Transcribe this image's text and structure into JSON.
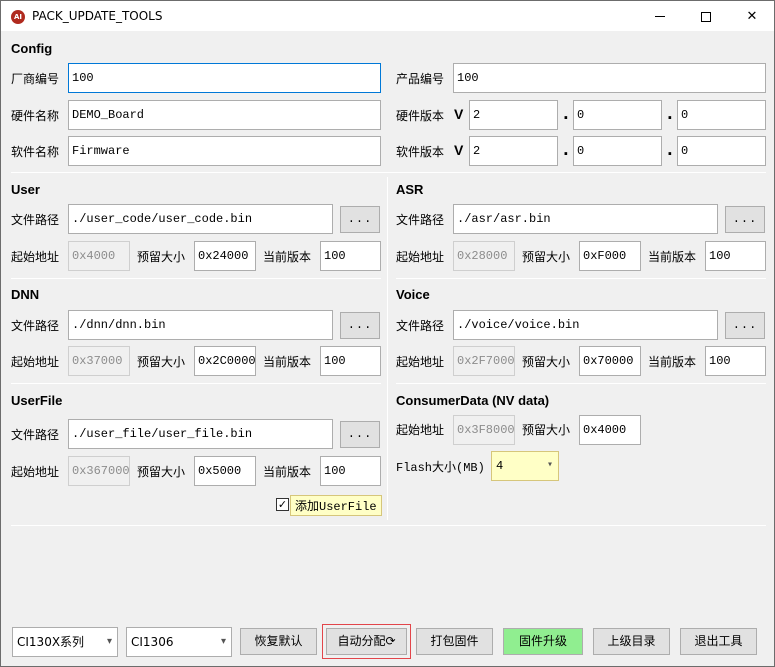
{
  "window": {
    "app_icon": "AI",
    "title": "PACK_UPDATE_TOOLS",
    "minimize_glyph": "—",
    "close_glyph": "✕"
  },
  "config": {
    "section": "Config",
    "vendor_label": "厂商编号",
    "vendor_value": "100",
    "product_label": "产品编号",
    "product_value": "100",
    "hw_name_label": "硬件名称",
    "hw_name_value": "DEMO_Board",
    "hw_ver_label": "硬件版本",
    "hw_ver_v": "V",
    "hw_ver": [
      "2",
      "0",
      "0"
    ],
    "sw_name_label": "软件名称",
    "sw_name_value": "Firmware",
    "sw_ver_label": "软件版本",
    "sw_ver_v": "V",
    "sw_ver": [
      "2",
      "0",
      "0"
    ],
    "dot": "."
  },
  "labels": {
    "path": "文件路径",
    "start": "起始地址",
    "reserve": "预留大小",
    "version": "当前版本",
    "browse": "..."
  },
  "user": {
    "section": "User",
    "path": "./user_code/user_code.bin",
    "start": "0x4000",
    "reserve": "0x24000",
    "version": "100"
  },
  "asr": {
    "section": "ASR",
    "path": "./asr/asr.bin",
    "start": "0x28000",
    "reserve": "0xF000",
    "version": "100"
  },
  "dnn": {
    "section": "DNN",
    "path": "./dnn/dnn.bin",
    "start": "0x37000",
    "reserve": "0x2C0000",
    "version": "100"
  },
  "voice": {
    "section": "Voice",
    "path": "./voice/voice.bin",
    "start": "0x2F7000",
    "reserve": "0x70000",
    "version": "100"
  },
  "userfile": {
    "section": "UserFile",
    "path": "./user_file/user_file.bin",
    "start": "0x367000",
    "reserve": "0x5000",
    "version": "100",
    "add_label": "添加UserFile",
    "add_checked": true,
    "check_glyph": "✓"
  },
  "consumer": {
    "section": "ConsumerData (NV data)",
    "start": "0x3F8000",
    "reserve": "0x4000",
    "flash_label": "Flash大小(MB)",
    "flash_value": "4"
  },
  "bottom": {
    "series_value": "CI130X系列",
    "chip_value": "CI1306",
    "restore_default": "恢复默认",
    "auto_allocate": "自动分配",
    "auto_glyph": "⟳",
    "pack_firmware": "打包固件",
    "firmware_upgrade": "固件升级",
    "parent_dir": "上级目录",
    "exit_tool": "退出工具",
    "combo_arrow": "▾"
  }
}
